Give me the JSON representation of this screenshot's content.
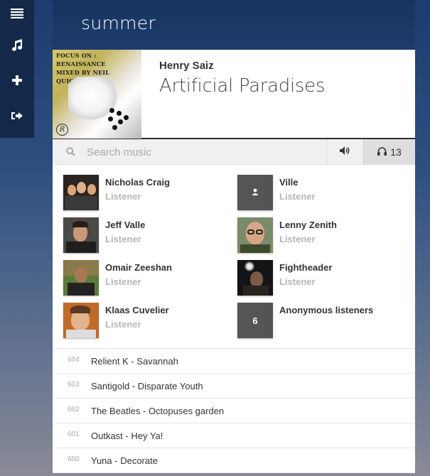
{
  "sidebar": {
    "items": [
      {
        "icon": "menu-icon"
      },
      {
        "icon": "music-note-icon"
      },
      {
        "icon": "plus-icon"
      },
      {
        "icon": "sign-out-icon"
      }
    ]
  },
  "room": {
    "title": "summer"
  },
  "now_playing": {
    "artist": "Henry Saiz",
    "title": "Artificial Paradises",
    "album_art_text_line1": "FOCUS ON : RENAISSANCE",
    "album_art_text_line2": "MIXED BY NEIL QUIGLEY",
    "album_art_logo": "R"
  },
  "search": {
    "placeholder": "Search music",
    "value": ""
  },
  "controls": {
    "listener_count": "13"
  },
  "listeners": [
    {
      "name": "Nicholas Craig",
      "role": "Listener"
    },
    {
      "name": "Ville",
      "role": "Listener"
    },
    {
      "name": "Jeff Valle",
      "role": "Listener"
    },
    {
      "name": "Lenny Zenith",
      "role": "Listener"
    },
    {
      "name": "Omair Zeeshan",
      "role": "Listener"
    },
    {
      "name": "Fightheader",
      "role": "Listener"
    },
    {
      "name": "Klaas Cuvelier",
      "role": "Listener"
    },
    {
      "name": "Anonymous listeners",
      "count": "6"
    }
  ],
  "history": [
    {
      "num": "604",
      "title": "Relient K - Savannah"
    },
    {
      "num": "603",
      "title": "Santigold - Disparate Youth"
    },
    {
      "num": "602",
      "title": "The Beatles - Octopuses garden"
    },
    {
      "num": "601",
      "title": "Outkast - Hey Ya!"
    },
    {
      "num": "600",
      "title": "Yuna - Decorate"
    }
  ],
  "colors": {
    "sidebar_bg": "#14294a",
    "header_bg": "#1e3c6c",
    "listeners_btn_bg": "#dedede"
  }
}
